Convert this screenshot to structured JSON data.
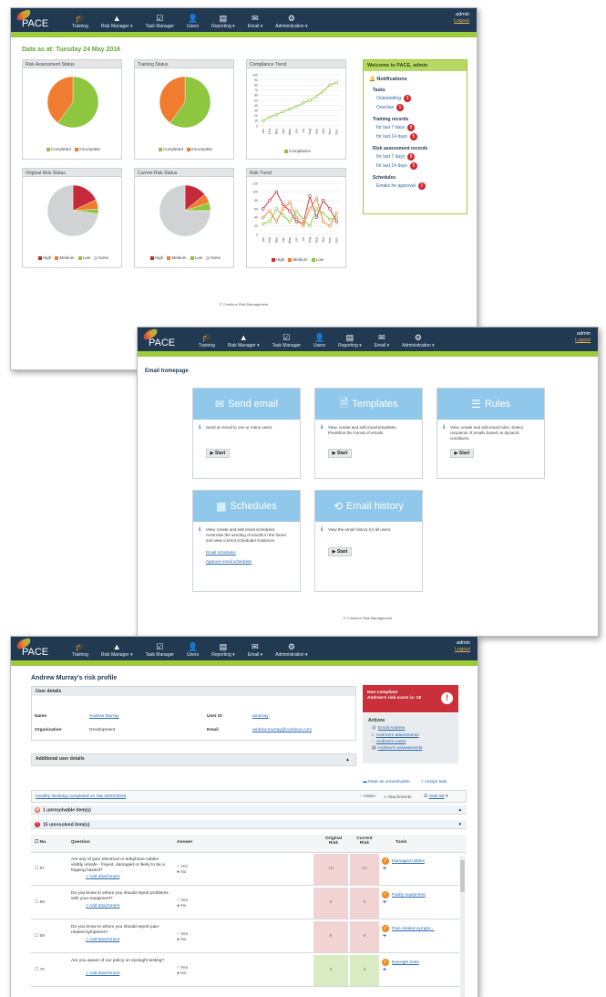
{
  "nav": {
    "logo": "PACE",
    "items": [
      {
        "label": "Training",
        "icon": "training-icon",
        "glyph": "🎓"
      },
      {
        "label": "Risk Manager ▾",
        "icon": "warning-icon",
        "glyph": "▲"
      },
      {
        "label": "Task Manager",
        "icon": "checklist-icon",
        "glyph": "☑"
      },
      {
        "label": "Users",
        "icon": "user-icon",
        "glyph": "👤"
      },
      {
        "label": "Reporting ▾",
        "icon": "report-icon",
        "glyph": "▤"
      },
      {
        "label": "Email ▾",
        "icon": "envelope-icon",
        "glyph": "✉"
      },
      {
        "label": "Administration ▾",
        "icon": "gear-icon",
        "glyph": "⚙"
      }
    ],
    "user": "admin",
    "logout": "Logout"
  },
  "dashboard": {
    "date_line": "Data as at: Tuesday 24 May 2016",
    "panels": {
      "risk_assessment": "Risk Assessment Status",
      "training": "Training Status",
      "compliance": "Compliance Trend",
      "original_risk": "Original Risk Status",
      "current_risk": "Current Risk Status",
      "risk_trend": "Risk Trend"
    },
    "legend_status": [
      "Completed",
      "InComplete"
    ],
    "legend_compliance": "Compliance",
    "legend_risk": [
      "High",
      "Medium",
      "Low",
      "None"
    ],
    "legend_risk_trend": [
      "High",
      "Medium",
      "Low"
    ],
    "colors": {
      "green": "#8dc63f",
      "orange": "#f07c2f",
      "red": "#c62a3a",
      "grey": "#d0d2d4"
    },
    "chart_data": [
      {
        "type": "pie",
        "title": "Risk Assessment Status",
        "slices": [
          {
            "name": "Completed",
            "value": 60
          },
          {
            "name": "InComplete",
            "value": 40
          }
        ]
      },
      {
        "type": "pie",
        "title": "Training Status",
        "slices": [
          {
            "name": "Completed",
            "value": 60
          },
          {
            "name": "InComplete",
            "value": 40
          }
        ]
      },
      {
        "type": "line",
        "title": "Compliance Trend",
        "categories": [
          "Jan",
          "Feb",
          "Mar",
          "Apr",
          "May",
          "Jun",
          "Jul",
          "Aug",
          "Sep",
          "Oct",
          "Nov",
          "Dec"
        ],
        "ylim": [
          0,
          100
        ],
        "yticks": [
          0,
          10,
          20,
          30,
          40,
          50,
          60,
          70,
          80,
          90,
          100
        ],
        "series": [
          {
            "name": "Compliance",
            "values": [
              10,
              17,
              22,
              28,
              33,
              38,
              45,
              50,
              58,
              68,
              80,
              85
            ]
          }
        ]
      },
      {
        "type": "pie",
        "title": "Original Risk Status",
        "slices": [
          {
            "name": "High",
            "value": 18
          },
          {
            "name": "Medium",
            "value": 6
          },
          {
            "name": "Low",
            "value": 3
          },
          {
            "name": "None",
            "value": 73
          }
        ]
      },
      {
        "type": "pie",
        "title": "Current Risk Status",
        "slices": [
          {
            "name": "High",
            "value": 14
          },
          {
            "name": "Medium",
            "value": 6
          },
          {
            "name": "Low",
            "value": 5
          },
          {
            "name": "None",
            "value": 75
          }
        ]
      },
      {
        "type": "line",
        "title": "Risk Trend",
        "categories": [
          "Jan",
          "Feb",
          "Mar",
          "Apr",
          "May",
          "Jun",
          "Jul",
          "Aug",
          "Sep",
          "Oct",
          "Nov",
          "Dec"
        ],
        "ylim": [
          0,
          120
        ],
        "yticks": [
          0,
          20,
          40,
          60,
          80,
          100,
          120
        ],
        "series": [
          {
            "name": "High",
            "values": [
              60,
              80,
              100,
              70,
              55,
              30,
              25,
              90,
              40,
              80,
              60,
              30
            ]
          },
          {
            "name": "Medium",
            "values": [
              40,
              55,
              30,
              60,
              75,
              40,
              20,
              60,
              85,
              30,
              20,
              50
            ]
          },
          {
            "name": "Low",
            "values": [
              25,
              30,
              60,
              45,
              30,
              55,
              35,
              20,
              60,
              50,
              35,
              40
            ]
          }
        ]
      }
    ],
    "welcome": {
      "title": "Welcome to PACE, admin",
      "notifications": "Notifications",
      "sections": [
        {
          "title": "Tasks",
          "items": [
            {
              "label": "Outstanding",
              "count": "3"
            },
            {
              "label": "Overdue",
              "count": "5"
            }
          ]
        },
        {
          "title": "Training records",
          "items": [
            {
              "label": "for last 7 days",
              "count": "8"
            },
            {
              "label": "for last 14 days",
              "count": "5"
            }
          ]
        },
        {
          "title": "Risk assessment records",
          "items": [
            {
              "label": "for last 7 days",
              "count": "8"
            },
            {
              "label": "for last 14 days",
              "count": "5"
            }
          ]
        },
        {
          "title": "Schedules",
          "items": [
            {
              "label": "Emails for approval",
              "count": "2"
            }
          ]
        }
      ]
    },
    "footer": "© Continuo Risk Management"
  },
  "email": {
    "heading": "Email homepage",
    "cards": [
      {
        "title": "Send email",
        "icon": "envelope-icon",
        "glyph": "✉",
        "desc": "Send an email to one or many users.",
        "start": "▶ Start"
      },
      {
        "title": "Templates",
        "icon": "document-icon",
        "glyph": "🗎",
        "desc": "View, create and edit email templates. Predefine the format of emails.",
        "start": "▶ Start"
      },
      {
        "title": "Rules",
        "icon": "list-icon",
        "glyph": "☰",
        "desc": "View, create and edit email rules. Select recipients of emails based on dynamic conditions.",
        "start": "▶ Start"
      },
      {
        "title": "Schedules",
        "icon": "calendar-icon",
        "glyph": "▦",
        "desc": "View, create and edit email schedules. Automate the sending of emails in the future and view current scheduled instances.",
        "links": [
          "Email schedules",
          "Approve email schedules"
        ]
      },
      {
        "title": "Email history",
        "icon": "history-icon",
        "glyph": "⟲",
        "desc": "View the email history for all users.",
        "start": "▶ Start"
      }
    ],
    "footer": "© Continuo Risk Management"
  },
  "profile": {
    "title": "Andrew Murray's risk profile",
    "user_details": "User details",
    "name_label": "Name",
    "name_value": "Andrew Murray",
    "userid_label": "User ID",
    "userid_value": "amurray",
    "org_label": "Organisation",
    "org_value": "Development",
    "email_label": "Email",
    "email_value": "andrew.murray@continuo.com",
    "additional": "Additional user details",
    "noncompliant_line1": "Non compliant",
    "noncompliant_line2": "Andrew's risk score is: 18",
    "actions_title": "Actions",
    "actions": [
      "Email Andrew",
      "Andrew's attachments",
      "Andrew's notes",
      "Andrew's assessments"
    ],
    "mark_unresolvable": "Mark as unresolvable",
    "assign_task": "Assign task",
    "assessment_link": "Healthy Working completed on Sat 20/02/2016",
    "notes": "Notes",
    "attachments": "Attachments",
    "task_list": "Task list",
    "unresolvable": "1 unresolvable item(s)",
    "unresolved": "15 unresolved item(s)",
    "cols": {
      "no": "No.",
      "question": "Question",
      "answer": "Answer",
      "original": "Original Risk",
      "current": "Current Risk",
      "tools": "Tools"
    },
    "rows": [
      {
        "no": "67",
        "question": "Are any of your electrical or telephone cables visibly unsafe - frayed, damaged or likely to be a tripping hazard?",
        "attach": "Add attachment",
        "answers": "○ Yes\n● No",
        "orig": "10",
        "curr": "10",
        "tool": "Damaged cables",
        "risk": "high"
      },
      {
        "no": "68",
        "question": "Do you know to whom you should report problems with your equipment?",
        "attach": "Add attachment",
        "answers": "○ Yes\n● No",
        "orig": "8",
        "curr": "8",
        "tool": "Faulty equipment",
        "risk": "high"
      },
      {
        "no": "69",
        "question": "Do you know to whom you should report pain-related symptoms?",
        "attach": "Add attachment",
        "answers": "○ Yes\n● No",
        "orig": "8",
        "curr": "8",
        "tool": "Pain related sympto...",
        "risk": "high"
      },
      {
        "no": "70",
        "question": "Are you aware of our policy on eyesight testing?",
        "attach": "Add attachment",
        "answers": "○ Yes\n● No",
        "orig": "3",
        "curr": "3",
        "tool": "Eyesight tests",
        "risk": "low"
      }
    ]
  }
}
